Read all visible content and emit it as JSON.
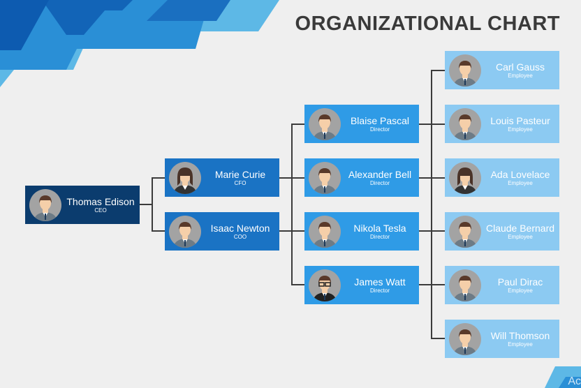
{
  "title": "ORGANIZATIONAL CHART",
  "colors": {
    "ceo": "#0b3c6e",
    "executive": "#1a73c4",
    "director": "#2f9be6",
    "employee": "#8ccaf2",
    "connector": "#3b3b3b"
  },
  "ceo": {
    "name": "Thomas Edison",
    "role": "CEO"
  },
  "executives": [
    {
      "name": "Marie Curie",
      "role": "CFO",
      "avatar": "female"
    },
    {
      "name": "Isaac Newton",
      "role": "COO",
      "avatar": "male"
    }
  ],
  "directors": [
    {
      "name": "Blaise Pascal",
      "role": "Director"
    },
    {
      "name": "Alexander Bell",
      "role": "Director"
    },
    {
      "name": "Nikola Tesla",
      "role": "Director"
    },
    {
      "name": "James Watt",
      "role": "Director",
      "avatar": "male-glasses"
    }
  ],
  "employees": [
    {
      "name": "Carl Gauss",
      "role": "Employee"
    },
    {
      "name": "Louis Pasteur",
      "role": "Employee"
    },
    {
      "name": "Ada Lovelace",
      "role": "Employee",
      "avatar": "female"
    },
    {
      "name": "Claude Bernard",
      "role": "Employee"
    },
    {
      "name": "Paul Dirac",
      "role": "Employee"
    },
    {
      "name": "Will Thomson",
      "role": "Employee"
    }
  ],
  "watermark": "Ac"
}
